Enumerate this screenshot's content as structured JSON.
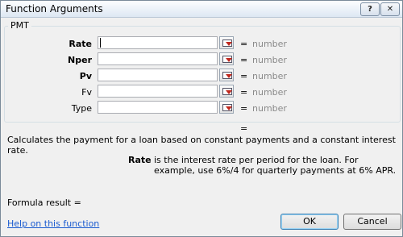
{
  "window": {
    "title": "Function Arguments",
    "help_glyph": "?",
    "close_glyph": "✕"
  },
  "function": {
    "name": "PMT"
  },
  "arguments": [
    {
      "label": "Rate",
      "bold": true,
      "value": "",
      "result": "number"
    },
    {
      "label": "Nper",
      "bold": true,
      "value": "",
      "result": "number"
    },
    {
      "label": "Pv",
      "bold": true,
      "value": "",
      "result": "number"
    },
    {
      "label": "Fv",
      "bold": false,
      "value": "",
      "result": "number"
    },
    {
      "label": "Type",
      "bold": false,
      "value": "",
      "result": "number"
    }
  ],
  "equals_sign": "=",
  "description": "Calculates the payment for a loan based on constant payments and a constant interest rate.",
  "argument_detail": {
    "label": "Rate",
    "text": "is the interest rate per period for the loan. For example, use 6%/4 for quarterly payments at 6% APR."
  },
  "formula_result": "Formula result =",
  "help_link": "Help on this function",
  "buttons": {
    "ok": "OK",
    "cancel": "Cancel"
  }
}
